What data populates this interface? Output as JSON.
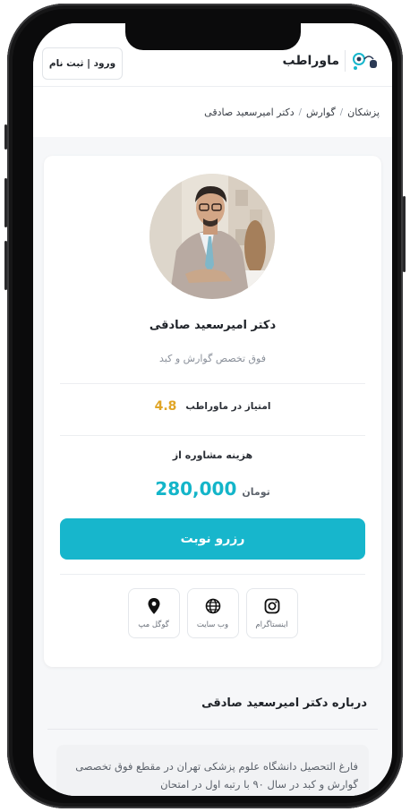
{
  "header": {
    "brand": "ماوراطب",
    "auth_label": "ورود | ثبت نام"
  },
  "breadcrumb": {
    "items": [
      "پزشکان",
      "گوارش",
      "دکتر امیرسعید صادقی"
    ],
    "separator": "/"
  },
  "doctor": {
    "name": "دکتر امیرسعید صادقی",
    "specialty": "فوق تخصص گوارش و کبد",
    "rating_label": "امتیاز در ماوراطب",
    "rating": "4.8",
    "fee_label": "هزینه مشاوره از",
    "fee": "280,000",
    "fee_unit": "تومان",
    "book_label": "رزرو نوبت"
  },
  "socials": [
    {
      "label": "اینستاگرام",
      "icon": "instagram-icon"
    },
    {
      "label": "وب سایت",
      "icon": "globe-icon"
    },
    {
      "label": "گوگل مپ",
      "icon": "map-pin-icon"
    }
  ],
  "about": {
    "title": "درباره دکتر امیرسعید صادقی",
    "text": "فارغ التحصیل دانشگاه علوم پزشکی تهران در مقطع فوق تخصصی گوارش و کبد در سال ۹۰ با رتبه اول در امتحان"
  },
  "colors": {
    "accent": "#17b6cc",
    "fee_color": "#13b5c9",
    "rating_color": "#e0a526"
  }
}
